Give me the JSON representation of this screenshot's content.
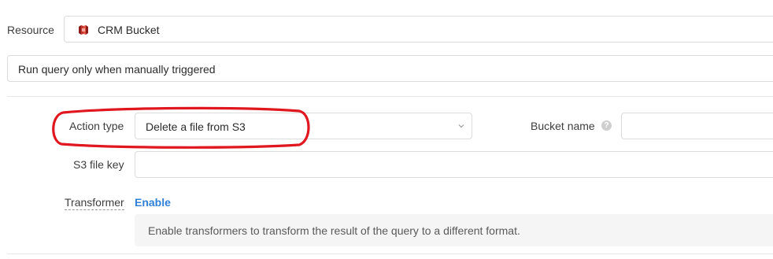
{
  "resource": {
    "label": "Resource",
    "value": "CRM Bucket",
    "icon": "s3-bucket-icon",
    "icon_color": "#c7372f"
  },
  "trigger": {
    "value": "Run query only when manually triggered"
  },
  "action_type": {
    "label": "Action type",
    "value": "Delete a file from S3",
    "highlight_color": "#e0171f"
  },
  "bucket_name": {
    "label": "Bucket name",
    "help": "?",
    "value": ""
  },
  "s3_file_key": {
    "label": "S3 file key",
    "value": ""
  },
  "transformer": {
    "label": "Transformer",
    "enable_label": "Enable",
    "info": "Enable transformers to transform the result of the query to a different format."
  }
}
